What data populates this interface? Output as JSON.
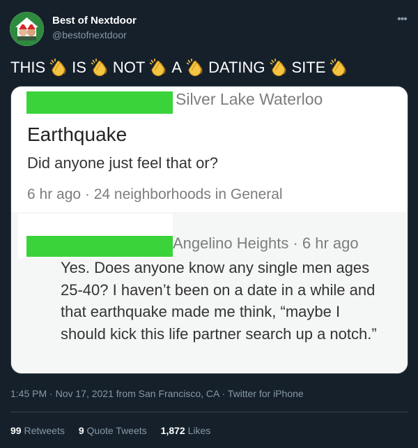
{
  "author": {
    "display_name": "Best of Nextdoor",
    "handle": "@bestofnextdoor"
  },
  "more_icon": "more-horizontal-icon",
  "tweet_text": {
    "words": [
      "THIS",
      "IS",
      "NOT",
      "A",
      "DATING",
      "SITE"
    ],
    "separator_icon": "clapping-hands-emoji"
  },
  "media": {
    "post": {
      "neighborhood": "Silver Lake Waterloo",
      "title": "Earthquake",
      "body": "Did anyone just feel that or?",
      "meta": "6 hr ago · 24 neighborhoods in General"
    },
    "reply": {
      "header": "Angelino Heights · 6 hr ago",
      "text": "Yes. Does anyone know any single men ages 25-40? I haven’t been on a date in a while and that earthquake made me think, “maybe I should kick this life partner search up a notch.”"
    },
    "redaction_color": "#3ad33a"
  },
  "timestamp": "1:45 PM · Nov 17, 2021 from San Francisco, CA · Twitter for iPhone",
  "stats": {
    "retweets_count": "99",
    "retweets_label": "Retweets",
    "quote_tweets_count": "9",
    "quote_tweets_label": "Quote Tweets",
    "likes_count": "1,872",
    "likes_label": "Likes"
  },
  "colors": {
    "background": "#15202b",
    "secondary_text": "#8899a6",
    "divider": "#38444d"
  }
}
